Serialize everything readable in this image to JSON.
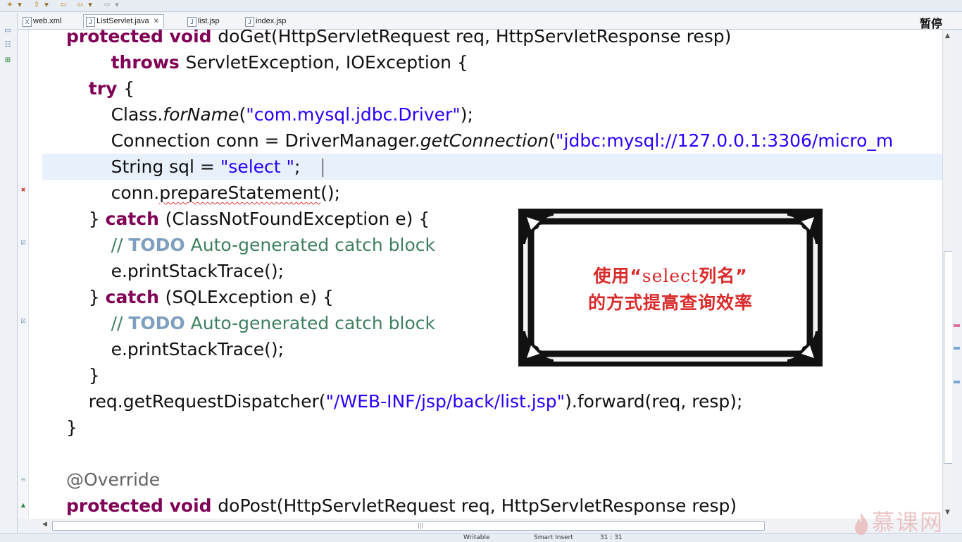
{
  "toolbar": {
    "icons": [
      "new-icon",
      "open-icon",
      "back-icon",
      "forward-icon",
      "history-icon"
    ]
  },
  "tabs": [
    {
      "label": "web.xml",
      "icon": "xml-file-icon",
      "active": false
    },
    {
      "label": "ListServlet.java",
      "icon": "java-file-icon",
      "active": true,
      "close": "✕"
    },
    {
      "label": "list.jsp",
      "icon": "jsp-file-icon",
      "active": false
    },
    {
      "label": "index.jsp",
      "icon": "jsp-file-icon",
      "active": false
    }
  ],
  "editor": {
    "lines": [
      {
        "segments": [
          {
            "t": "protected void ",
            "c": "kw"
          },
          {
            "t": "doGet(HttpServletRequest req, HttpServletResponse resp)"
          }
        ]
      },
      {
        "segments": [
          {
            "t": "        "
          },
          {
            "t": "throws ",
            "c": "kw"
          },
          {
            "t": "ServletException, IOException {"
          }
        ]
      },
      {
        "segments": [
          {
            "t": "    "
          },
          {
            "t": "try ",
            "c": "kw"
          },
          {
            "t": "{"
          }
        ]
      },
      {
        "segments": [
          {
            "t": "        Class."
          },
          {
            "t": "forName",
            "c": "it"
          },
          {
            "t": "("
          },
          {
            "t": "\"com.mysql.jdbc.Driver\"",
            "c": "str"
          },
          {
            "t": ");"
          }
        ]
      },
      {
        "segments": [
          {
            "t": "        Connection conn = DriverManager."
          },
          {
            "t": "getConnection",
            "c": "it"
          },
          {
            "t": "("
          },
          {
            "t": "\"jdbc:mysql://127.0.0.1:3306/micro_m",
            "c": "str"
          }
        ]
      },
      {
        "segments": [
          {
            "t": "        String sql = "
          },
          {
            "t": "\"select \"",
            "c": "str"
          },
          {
            "t": ";"
          }
        ],
        "highlight": true
      },
      {
        "segments": [
          {
            "t": "        conn."
          },
          {
            "t": "prepareStatement",
            "c": "squig"
          },
          {
            "t": "();"
          }
        ]
      },
      {
        "segments": [
          {
            "t": "    } "
          },
          {
            "t": "catch ",
            "c": "kw"
          },
          {
            "t": "(ClassNotFoundException e) {"
          }
        ]
      },
      {
        "segments": [
          {
            "t": "        "
          },
          {
            "t": "// ",
            "c": "cm"
          },
          {
            "t": "TODO",
            "c": "todo"
          },
          {
            "t": " Auto-generated catch block",
            "c": "cm"
          }
        ]
      },
      {
        "segments": [
          {
            "t": "        e.printStackTrace();"
          }
        ]
      },
      {
        "segments": [
          {
            "t": "    } "
          },
          {
            "t": "catch ",
            "c": "kw"
          },
          {
            "t": "(SQLException e) {"
          }
        ]
      },
      {
        "segments": [
          {
            "t": "        "
          },
          {
            "t": "// ",
            "c": "cm"
          },
          {
            "t": "TODO",
            "c": "todo"
          },
          {
            "t": " Auto-generated catch block",
            "c": "cm"
          }
        ]
      },
      {
        "segments": [
          {
            "t": "        e.printStackTrace();"
          }
        ]
      },
      {
        "segments": [
          {
            "t": "    }"
          }
        ]
      },
      {
        "segments": [
          {
            "t": "    req.getRequestDispatcher("
          },
          {
            "t": "\"/WEB-INF/jsp/back/list.jsp\"",
            "c": "str"
          },
          {
            "t": ").forward(req, resp);"
          }
        ]
      },
      {
        "segments": [
          {
            "t": "}"
          }
        ]
      },
      {
        "segments": [
          {
            "t": ""
          }
        ]
      },
      {
        "segments": [
          {
            "t": "@Override",
            "c": "ann"
          }
        ]
      },
      {
        "segments": [
          {
            "t": "protected void ",
            "c": "kw"
          },
          {
            "t": "doPost(HttpServletRequest req, HttpServletResponse resp)"
          }
        ]
      }
    ]
  },
  "overlay": {
    "pause_label": "暂停",
    "callout_line1_a": "使用“",
    "callout_line1_b": "select",
    "callout_line1_c": "列名”",
    "callout_line2": "的方式提高查询效率",
    "watermark": "慕课网"
  },
  "status": {
    "writable": "Writable",
    "insert_mode": "Smart Insert",
    "position": "31 : 31"
  },
  "colors": {
    "keyword": "#7f0055",
    "string": "#2a00ff",
    "comment": "#3f7f5f",
    "callout_text": "#d92b2b"
  }
}
